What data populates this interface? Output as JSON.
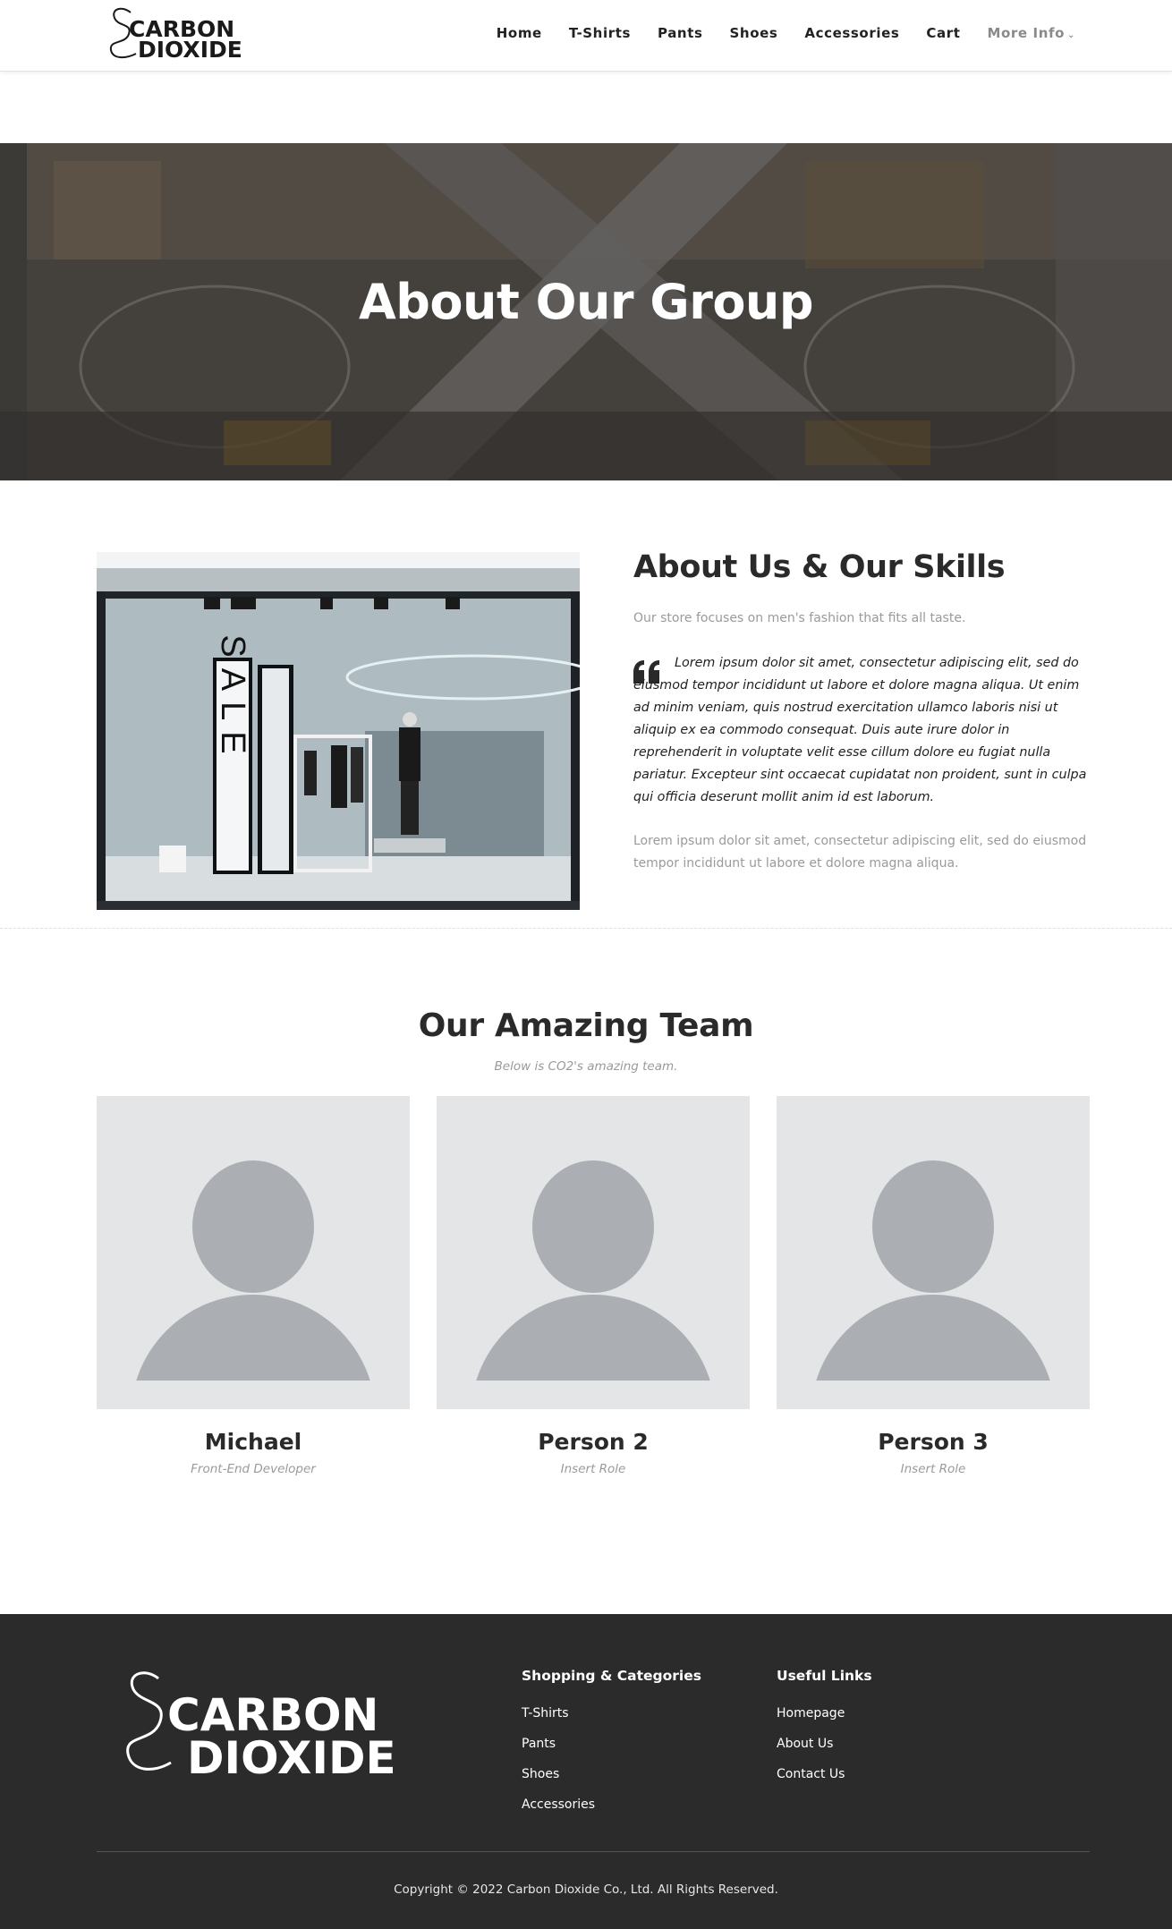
{
  "header": {
    "logo": {
      "line1": "CARBON",
      "line2": "DIOXIDE"
    },
    "nav": [
      {
        "label": "Home"
      },
      {
        "label": "T-Shirts"
      },
      {
        "label": "Pants"
      },
      {
        "label": "Shoes"
      },
      {
        "label": "Accessories"
      },
      {
        "label": "Cart"
      },
      {
        "label": "More Info",
        "icon": "chevron-down-icon"
      }
    ]
  },
  "hero": {
    "title": "About Our Group"
  },
  "about": {
    "image_text": "SALE",
    "title": "About Us & Our Skills",
    "lead": "Our store focuses on men's fashion that fits all taste.",
    "quote": "Lorem ipsum dolor sit amet, consectetur adipiscing elit, sed do eiusmod tempor incididunt ut labore et dolore magna aliqua. Ut enim ad minim veniam, quis nostrud exercitation ullamco laboris nisi ut aliquip ex ea commodo consequat. Duis aute irure dolor in reprehenderit in voluptate velit esse cillum dolore eu fugiat nulla pariatur. Excepteur sint occaecat cupidatat non proident, sunt in culpa qui officia deserunt mollit anim id est laborum.",
    "extra": "Lorem ipsum dolor sit amet, consectetur adipiscing elit, sed do eiusmod tempor incididunt ut labore et dolore magna aliqua."
  },
  "team": {
    "title": "Our Amazing Team",
    "subtitle": "Below is CO2's amazing team.",
    "members": [
      {
        "name": "Michael",
        "role": "Front-End Developer"
      },
      {
        "name": "Person 2",
        "role": "Insert Role"
      },
      {
        "name": "Person 3",
        "role": "Insert Role"
      }
    ]
  },
  "footer": {
    "logo": {
      "line1": "CARBON",
      "line2": "DIOXIDE"
    },
    "shopping": {
      "heading": "Shopping & Categories",
      "links": [
        "T-Shirts",
        "Pants",
        "Shoes",
        "Accessories"
      ]
    },
    "useful": {
      "heading": "Useful Links",
      "links": [
        "Homepage",
        "About Us",
        "Contact Us"
      ]
    },
    "copyright": "Copyright © 2022 Carbon Dioxide Co., Ltd. All Rights Reserved."
  },
  "colors": {
    "text_dark": "#2a2a2a",
    "text_muted": "#9a9a9a",
    "footer_bg": "#2b2b2b",
    "avatar_bg": "#e4e5e7",
    "avatar_fg": "#abafb3"
  }
}
